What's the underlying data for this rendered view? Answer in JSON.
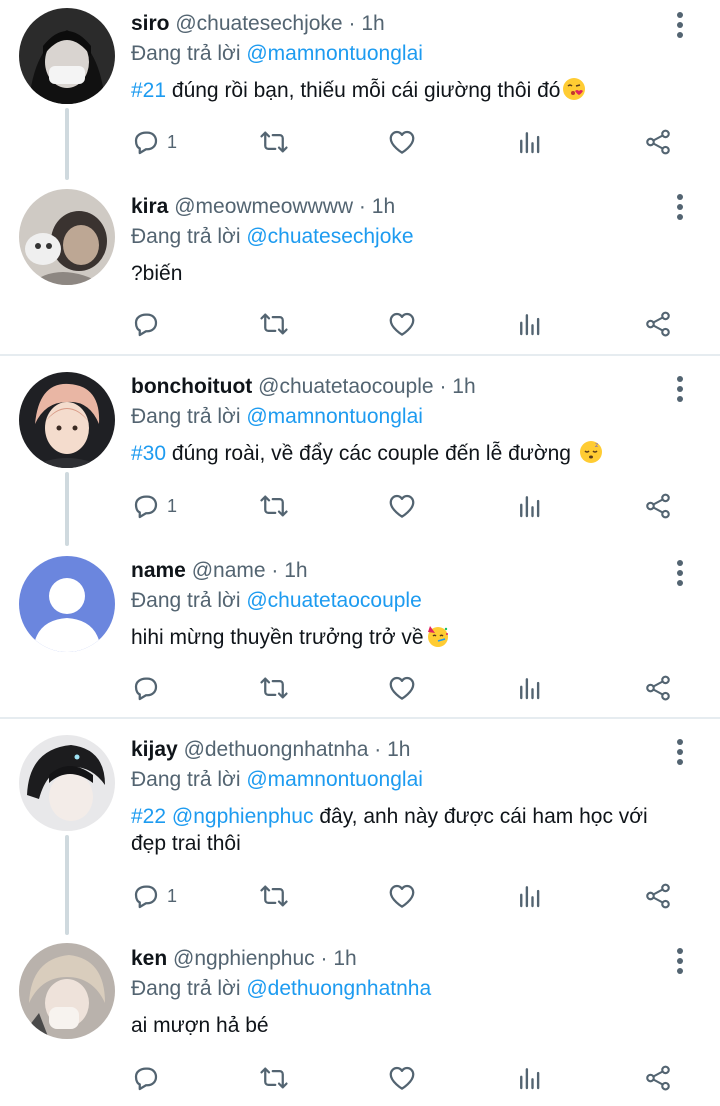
{
  "reply_prefix": "Đang trả lời",
  "tweets": [
    {
      "name": "siro",
      "handle": "@chuatesechjoke",
      "dot": "·",
      "time": "1h",
      "reply_to": "@mamnontuonglai",
      "hashtag": "#21",
      "text": "đúng rồi bạn, thiếu mỗi cái giường thôi đó",
      "text2": "",
      "mention_in_text": "",
      "emoji": "kissing-heart-emoji",
      "reply_count": "1"
    },
    {
      "name": "kira",
      "handle": "@meowmeowwww",
      "dot": "·",
      "time": "1h",
      "reply_to": "@chuatesechjoke",
      "hashtag": "",
      "text": "?biến",
      "text2": "",
      "mention_in_text": "",
      "emoji": "",
      "reply_count": ""
    },
    {
      "name": "bonchoituot",
      "handle": "@chuatetaocouple",
      "dot": "·",
      "time": "1h",
      "reply_to": "@mamnontuonglai",
      "hashtag": "#30",
      "text": "đúng roài, về đẩy các couple đến lễ đường",
      "text2": "",
      "mention_in_text": "",
      "emoji": "sleeping-face-emoji",
      "reply_count": "1"
    },
    {
      "name": "name",
      "handle": "@name",
      "dot": "·",
      "time": "1h",
      "reply_to": "@chuatetaocouple",
      "hashtag": "",
      "text": "hihi mừng thuyền trưởng trở về",
      "text2": "",
      "mention_in_text": "",
      "emoji": "partying-face-emoji",
      "reply_count": ""
    },
    {
      "name": "kijay",
      "handle": "@dethuongnhatnha",
      "dot": "·",
      "time": "1h",
      "reply_to": "@mamnontuonglai",
      "hashtag": "#22",
      "mention_in_text": "@ngphienphuc",
      "text": "đây, anh này được cái ham học với",
      "text2": "đẹp trai thôi",
      "emoji": "",
      "reply_count": "1"
    },
    {
      "name": "ken",
      "handle": "@ngphienphuc",
      "dot": "·",
      "time": "1h",
      "reply_to": "@dethuongnhatnha",
      "hashtag": "",
      "text": "ai mượn hả bé",
      "text2": "",
      "mention_in_text": "",
      "emoji": "",
      "reply_count": ""
    }
  ],
  "colors": {
    "link": "#1d9bf0",
    "secondary": "#536471",
    "primary": "#0f1419",
    "thread_line": "#cfd9de",
    "divider": "#e6ecf0"
  },
  "icons": [
    "reply-icon",
    "retweet-icon",
    "like-icon",
    "analytics-icon",
    "share-icon",
    "more-options-icon"
  ]
}
